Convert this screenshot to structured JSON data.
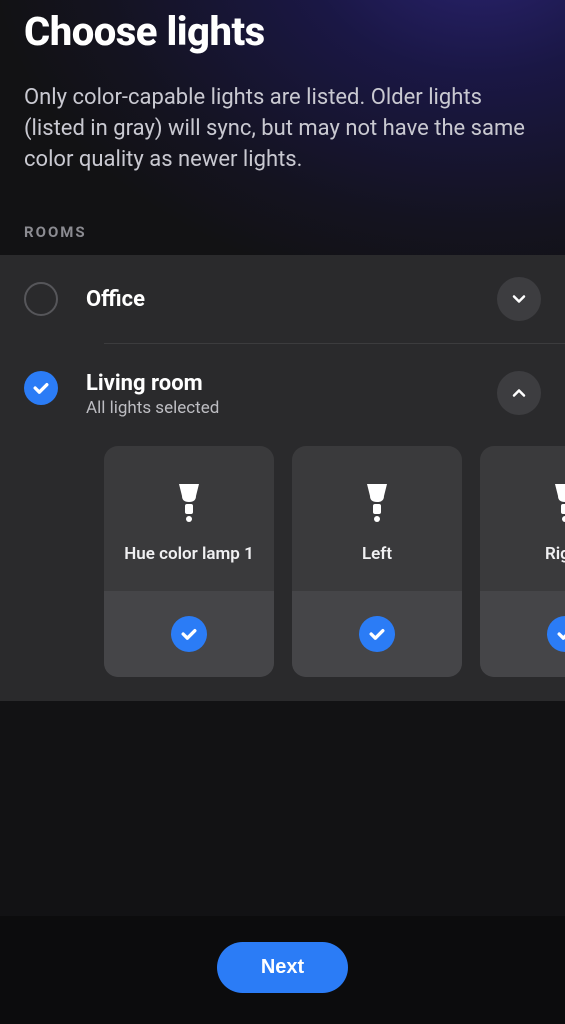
{
  "header": {
    "title": "Choose lights",
    "subtitle": "Only color-capable lights are listed. Older lights (listed in gray) will sync, but may not have the same color quality as newer lights."
  },
  "sectionLabel": "ROOMS",
  "rooms": [
    {
      "name": "Office",
      "selected": false,
      "expanded": false,
      "subtitle": ""
    },
    {
      "name": "Living room",
      "selected": true,
      "expanded": true,
      "subtitle": "All lights selected",
      "lights": [
        {
          "name": "Hue color lamp 1",
          "selected": true
        },
        {
          "name": "Left",
          "selected": true
        },
        {
          "name": "Right",
          "selected": true
        }
      ]
    }
  ],
  "footer": {
    "nextLabel": "Next"
  },
  "colors": {
    "accent": "#2b7cf6"
  }
}
